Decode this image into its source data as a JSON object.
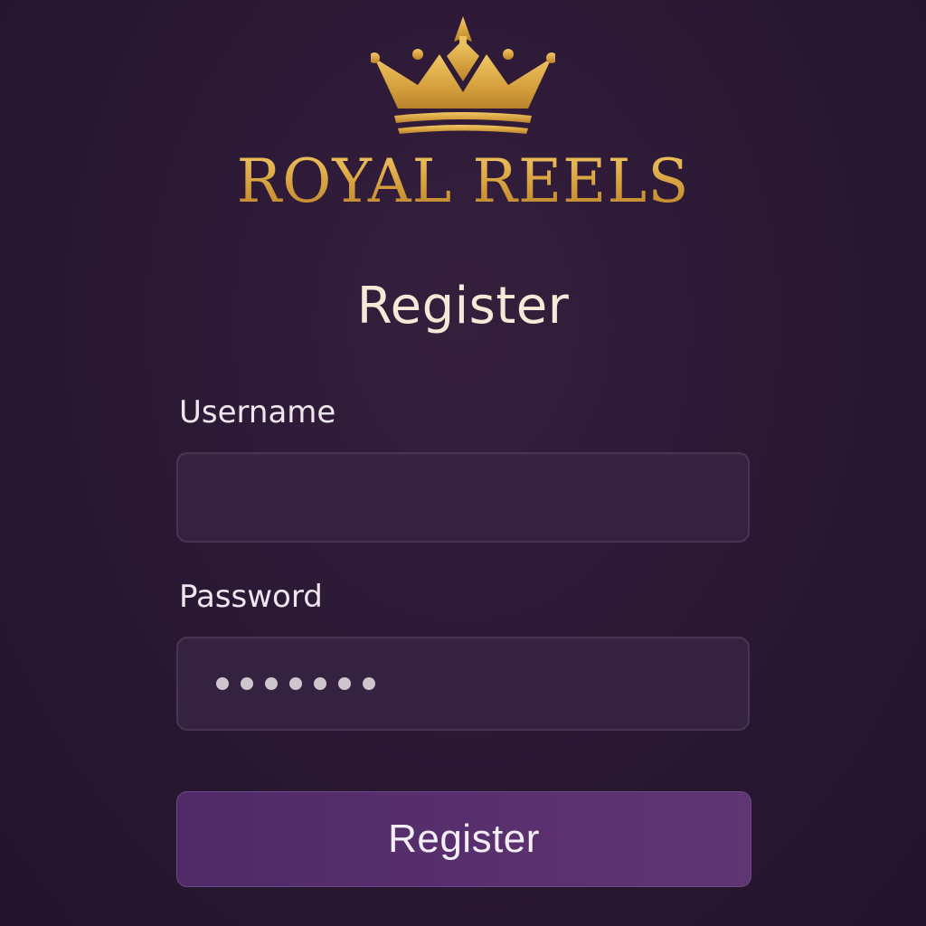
{
  "brand": {
    "name": "ROYAL REELS",
    "logo_icon": "crown-icon",
    "color": "#d9a845"
  },
  "form": {
    "title": "Register",
    "username": {
      "label": "Username",
      "value": "",
      "placeholder": ""
    },
    "password": {
      "label": "Password",
      "masked_length": 7
    },
    "submit_label": "Register"
  },
  "colors": {
    "background": "#2a1833",
    "input_background": "#342240",
    "button_background": "#5a306f",
    "title_text": "#f5ead8"
  }
}
